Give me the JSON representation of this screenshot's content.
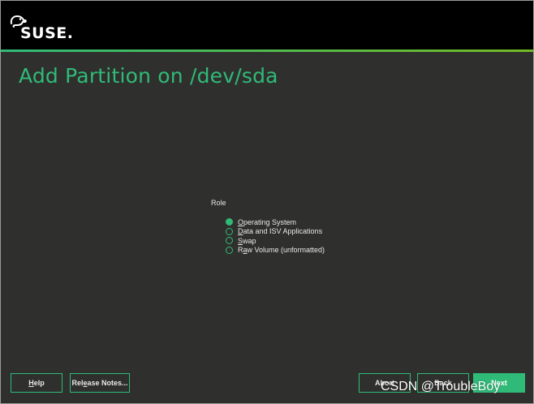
{
  "header": {
    "logo_text": "SUSE."
  },
  "page": {
    "title": "Add Partition on /dev/sda"
  },
  "role": {
    "label": "Role",
    "options": [
      {
        "mnemonic": "O",
        "rest": "perating System",
        "checked": true
      },
      {
        "mnemonic": "D",
        "rest": "ata and ISV Applications",
        "checked": false
      },
      {
        "mnemonic": "S",
        "rest": "wap",
        "checked": false
      },
      {
        "pre": "R",
        "mnemonic": "a",
        "rest": "w Volume (unformatted)",
        "checked": false
      }
    ]
  },
  "footer": {
    "help_mnemonic": "H",
    "help_rest": "elp",
    "release_notes_pre": "Rel",
    "release_notes_mnemonic": "e",
    "release_notes_rest": "ase Notes...",
    "abort_label": "Abort",
    "back_label": "Back",
    "next_label": "Next"
  },
  "watermark": {
    "text": "CSDN @TroubleBoy"
  },
  "colors": {
    "accent": "#30ba78",
    "background": "#2f302d",
    "header": "#000000"
  }
}
